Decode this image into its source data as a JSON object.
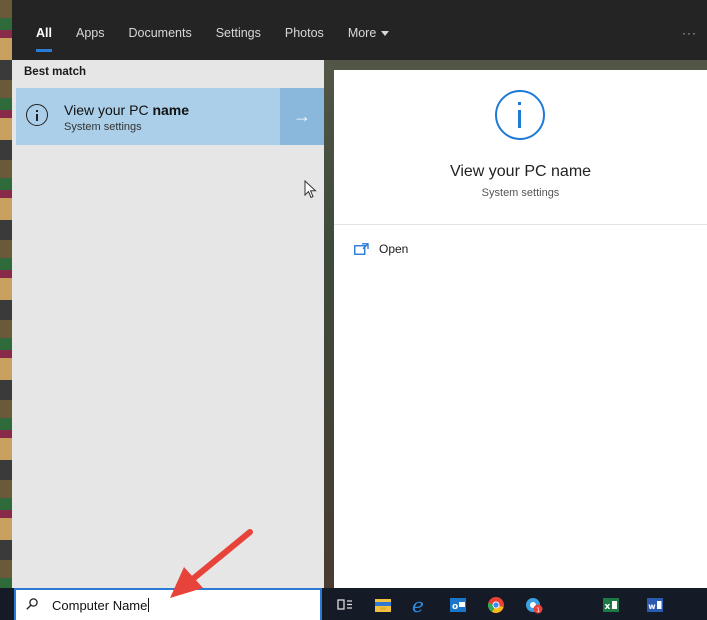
{
  "tabs": [
    {
      "label": "All",
      "active": true
    },
    {
      "label": "Apps"
    },
    {
      "label": "Documents"
    },
    {
      "label": "Settings"
    },
    {
      "label": "Photos"
    },
    {
      "label": "More"
    }
  ],
  "more_options": "···",
  "results": {
    "section_heading": "Best match",
    "best_match": {
      "title_prefix": "View your PC ",
      "title_bold": "name",
      "subtitle": "System settings",
      "arrow": "→"
    }
  },
  "preview": {
    "title": "View your PC name",
    "subtitle": "System settings",
    "actions": [
      {
        "label": "Open",
        "icon": "open-window-icon"
      }
    ]
  },
  "search": {
    "value": "Computer Name"
  },
  "taskbar_icons": [
    "task-view-icon",
    "file-explorer-icon",
    "edge-icon",
    "outlook-icon",
    "chrome-icon",
    "app-notification-icon",
    "excel-icon",
    "word-icon"
  ],
  "colors": {
    "accent": "#2b7bd6",
    "selected_result": "#abcfe9",
    "annotation": "#e8433a"
  }
}
